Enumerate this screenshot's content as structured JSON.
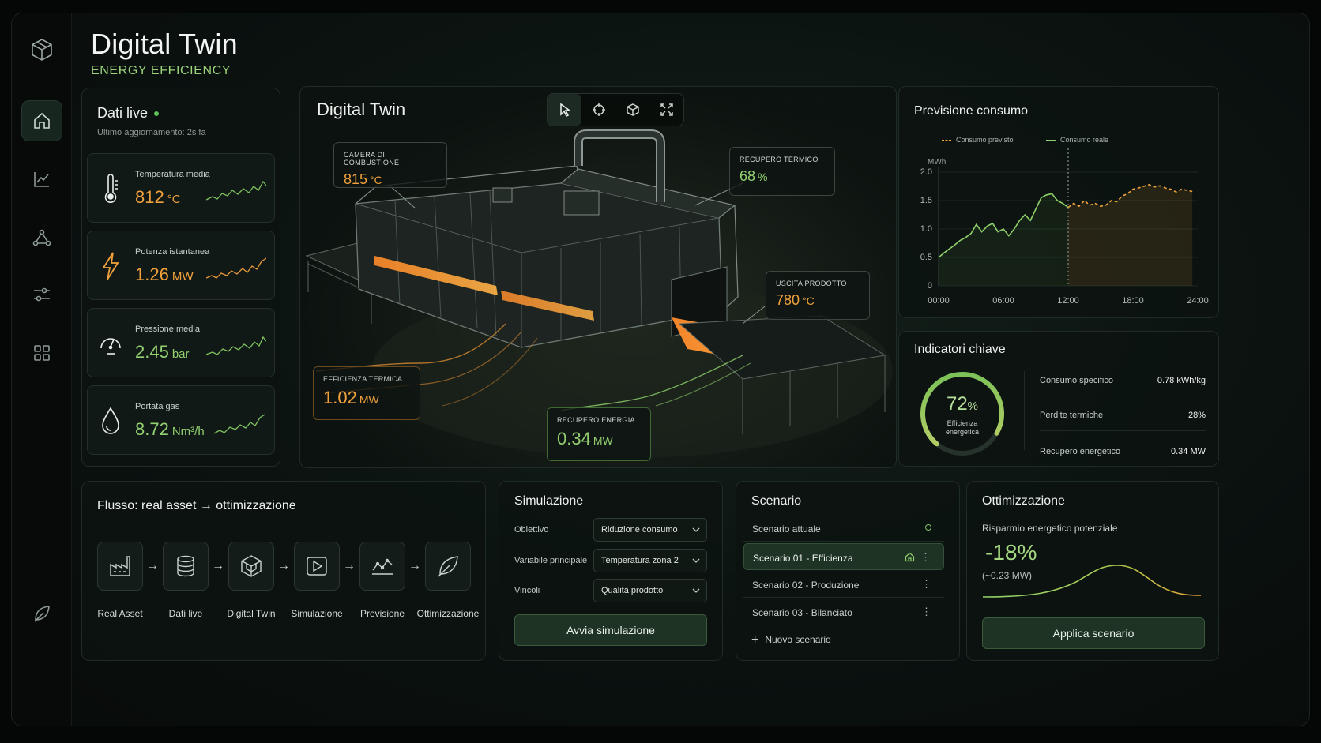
{
  "header": {
    "title": "Digital Twin",
    "subtitle": "ENERGY EFFICIENCY"
  },
  "sidebar": {
    "items": [
      {
        "icon": "home-icon",
        "active": true
      },
      {
        "icon": "chart-icon",
        "active": false
      },
      {
        "icon": "network-icon",
        "active": false
      },
      {
        "icon": "sliders-icon",
        "active": false
      },
      {
        "icon": "grid-icon",
        "active": false
      }
    ],
    "bottom_icon": "leaf-icon"
  },
  "live": {
    "title": "Dati live",
    "updated": "Ultimo aggiornamento: 2s fa",
    "metrics": [
      {
        "label": "Temperatura media",
        "value": "812",
        "unit": "°C",
        "color": "orange",
        "icon": "thermometer-icon"
      },
      {
        "label": "Potenza istantanea",
        "value": "1.26",
        "unit": "MW",
        "color": "orange",
        "icon": "lightning-icon"
      },
      {
        "label": "Pressione media",
        "value": "2.45",
        "unit": "bar",
        "color": "green",
        "icon": "gauge-icon"
      },
      {
        "label": "Portata gas",
        "value": "8.72",
        "unit": "Nm³/h",
        "color": "green",
        "icon": "drop-icon"
      }
    ]
  },
  "twin": {
    "title": "Digital Twin",
    "toolbar": [
      "cursor-icon",
      "target-icon",
      "cube-icon",
      "expand-icon"
    ],
    "callouts": {
      "combustion": {
        "label": "CAMERA DI COMBUSTIONE",
        "value": "815",
        "unit": "°C"
      },
      "heat_recovery": {
        "label": "RECUPERO TERMICO",
        "value": "68",
        "unit": "%"
      },
      "product_exit": {
        "label": "USCITA PRODOTTO",
        "value": "780",
        "unit": "°C"
      },
      "thermal_eff": {
        "label": "EFFICIENZA TERMICA",
        "value": "1.02",
        "unit": "MW"
      },
      "energy_recovery": {
        "label": "RECUPERO ENERGIA",
        "value": "0.34",
        "unit": "MW"
      }
    }
  },
  "forecast": {
    "title": "Previsione consumo",
    "legend_forecast": "Consumo previsto",
    "legend_real": "Consumo reale",
    "chart_data": {
      "type": "line",
      "ylabel": "MWh",
      "ylim": [
        0,
        2.0
      ],
      "yticks": [
        "0",
        "0.5",
        "1.0",
        "1.5",
        "2.0"
      ],
      "xticks": [
        "00:00",
        "06:00",
        "12:00",
        "18:00",
        "24:00"
      ],
      "xlim": [
        0,
        24
      ],
      "now": 12,
      "series": [
        {
          "name": "Consumo reale",
          "color": "#8fd06a",
          "x": [
            0,
            0.5,
            1,
            1.5,
            2,
            2.5,
            3,
            3.5,
            4,
            4.5,
            5,
            5.5,
            6,
            6.5,
            7,
            7.5,
            8,
            8.5,
            9,
            9.5,
            10,
            10.5,
            11,
            11.5,
            12
          ],
          "y": [
            0.5,
            0.58,
            0.65,
            0.72,
            0.8,
            0.85,
            0.92,
            1.08,
            0.95,
            1.05,
            1.1,
            0.95,
            1.0,
            0.88,
            1.0,
            1.15,
            1.25,
            1.15,
            1.35,
            1.55,
            1.6,
            1.62,
            1.5,
            1.45,
            1.38
          ]
        },
        {
          "name": "Consumo previsto",
          "color": "#f0a43a",
          "x": [
            12,
            12.5,
            13,
            13.5,
            14,
            14.5,
            15,
            15.5,
            16,
            16.5,
            17,
            17.5,
            18,
            18.5,
            19,
            19.5,
            20,
            20.5,
            21,
            21.5,
            22,
            22.5,
            23,
            23.5
          ],
          "y": [
            1.38,
            1.45,
            1.4,
            1.5,
            1.42,
            1.45,
            1.4,
            1.42,
            1.5,
            1.48,
            1.58,
            1.62,
            1.7,
            1.72,
            1.75,
            1.78,
            1.74,
            1.76,
            1.72,
            1.7,
            1.65,
            1.7,
            1.68,
            1.66
          ]
        }
      ]
    }
  },
  "kpi": {
    "title": "Indicatori chiave",
    "efficiency_value": "72",
    "efficiency_unit": "%",
    "efficiency_fraction": 0.72,
    "efficiency_label_1": "Efficienza",
    "efficiency_label_2": "energetica",
    "rows": [
      {
        "label": "Consumo specifico",
        "value": "0.78 kWh/kg"
      },
      {
        "label": "Perdite termiche",
        "value": "28%"
      },
      {
        "label": "Recupero energetico",
        "value": "0.34 MW"
      }
    ]
  },
  "flow": {
    "title": "Flusso: real asset → ottimizzazione",
    "steps": [
      {
        "label": "Real Asset",
        "icon": "factory-icon"
      },
      {
        "label": "Dati live",
        "icon": "database-icon"
      },
      {
        "label": "Digital Twin",
        "icon": "cube-icon"
      },
      {
        "label": "Simulazione",
        "icon": "play-icon"
      },
      {
        "label": "Previsione",
        "icon": "trend-icon"
      },
      {
        "label": "Ottimizzazione",
        "icon": "leaf-icon"
      }
    ],
    "arrow": "→"
  },
  "simulation": {
    "title": "Simulazione",
    "fields": [
      {
        "label": "Obiettivo",
        "value": "Riduzione consumo"
      },
      {
        "label": "Variabile principale",
        "value": "Temperatura zona 2"
      },
      {
        "label": "Vincoli",
        "value": "Qualità prodotto"
      }
    ],
    "button": "Avvia simulazione"
  },
  "scenario": {
    "title": "Scenario",
    "current": "Scenario attuale",
    "items": [
      {
        "label": "Scenario 01 - Efficienza",
        "active": true
      },
      {
        "label": "Scenario 02 - Produzione",
        "active": false
      },
      {
        "label": "Scenario 03 - Bilanciato",
        "active": false
      }
    ],
    "add": "Nuovo scenario",
    "dots": "⋮"
  },
  "optimization": {
    "title": "Ottimizzazione",
    "subtitle": "Risparmio energetico potenziale",
    "value": "-18%",
    "sub_value": "(~0.23 MW)",
    "button": "Applica scenario"
  }
}
